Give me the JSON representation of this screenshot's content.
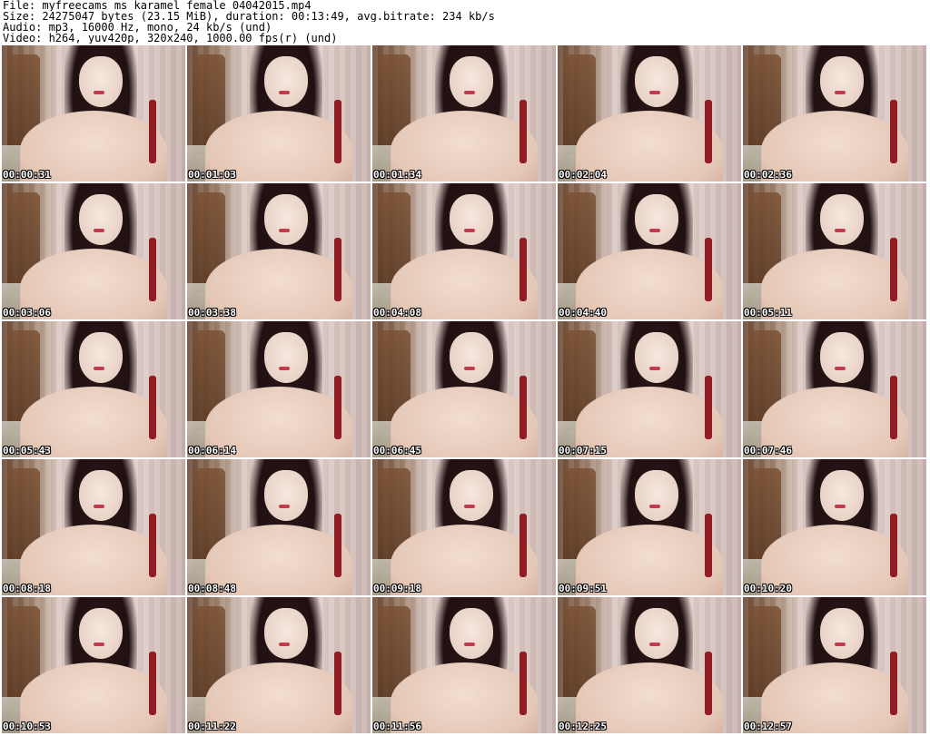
{
  "header": {
    "lines": [
      "File: myfreecams_ms_karamel_female_04042015.mp4",
      "Size: 24275047 bytes (23.15 MiB), duration: 00:13:49, avg.bitrate: 234 kb/s",
      "Audio: mp3, 16000 Hz, mono, 24 kb/s (und)",
      "Video: h264, yuv420p, 320x240, 1000.00 fps(r) (und)"
    ]
  },
  "thumbnails": [
    {
      "timestamp": "00:00:31"
    },
    {
      "timestamp": "00:01:03"
    },
    {
      "timestamp": "00:01:34"
    },
    {
      "timestamp": "00:02:04"
    },
    {
      "timestamp": "00:02:36"
    },
    {
      "timestamp": "00:03:06"
    },
    {
      "timestamp": "00:03:38"
    },
    {
      "timestamp": "00:04:08"
    },
    {
      "timestamp": "00:04:40"
    },
    {
      "timestamp": "00:05:11"
    },
    {
      "timestamp": "00:05:43"
    },
    {
      "timestamp": "00:06:14"
    },
    {
      "timestamp": "00:06:45"
    },
    {
      "timestamp": "00:07:15"
    },
    {
      "timestamp": "00:07:46"
    },
    {
      "timestamp": "00:08:18"
    },
    {
      "timestamp": "00:08:48"
    },
    {
      "timestamp": "00:09:18"
    },
    {
      "timestamp": "00:09:51"
    },
    {
      "timestamp": "00:10:20"
    },
    {
      "timestamp": "00:10:53"
    },
    {
      "timestamp": "00:11:22"
    },
    {
      "timestamp": "00:11:56"
    },
    {
      "timestamp": "00:12:25"
    },
    {
      "timestamp": "00:12:57"
    }
  ]
}
